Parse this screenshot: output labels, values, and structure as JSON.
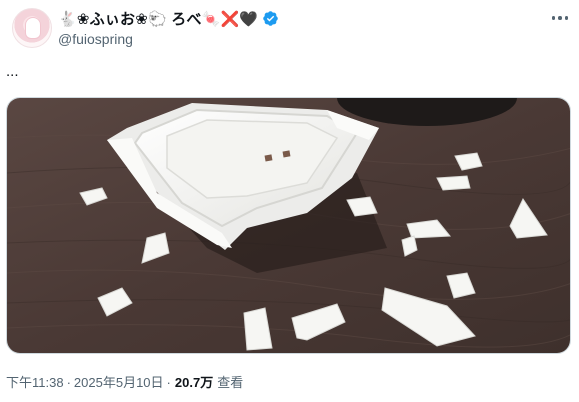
{
  "author": {
    "display_name": "🐇❀ふぃお❀🐑 ろべ🍬❌🖤",
    "handle": "@fuiospring",
    "verified_color": "#1d9bf0"
  },
  "tweet": {
    "text": "...",
    "time": "下午11:38",
    "separator": "·",
    "date": "2025年5月10日",
    "views": "20.7万",
    "views_label": "查看"
  },
  "colors": {
    "table": "#4a3935",
    "plastic": "#f2f2ef"
  },
  "icons": {
    "verified": "verified-badge-icon",
    "more": "more-options-icon"
  }
}
